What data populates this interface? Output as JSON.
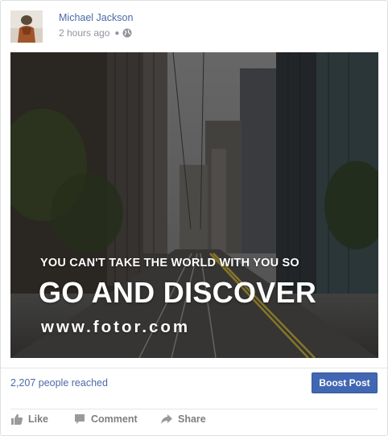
{
  "post": {
    "author": "Michael Jackson",
    "time": "2 hours ago",
    "privacy_icon": "globe-icon",
    "image": {
      "small_text": "YOU CAN'T TAKE THE WORLD WITH YOU SO",
      "big_text": "GO AND DISCOVER",
      "url_text": "www.fotor.com"
    }
  },
  "footer": {
    "reach": "2,207 people reached",
    "boost_label": "Boost Post"
  },
  "actions": {
    "like": "Like",
    "comment": "Comment",
    "share": "Share"
  },
  "colors": {
    "link": "#4b6aa6",
    "button": "#4267b2",
    "muted": "#90949c"
  }
}
